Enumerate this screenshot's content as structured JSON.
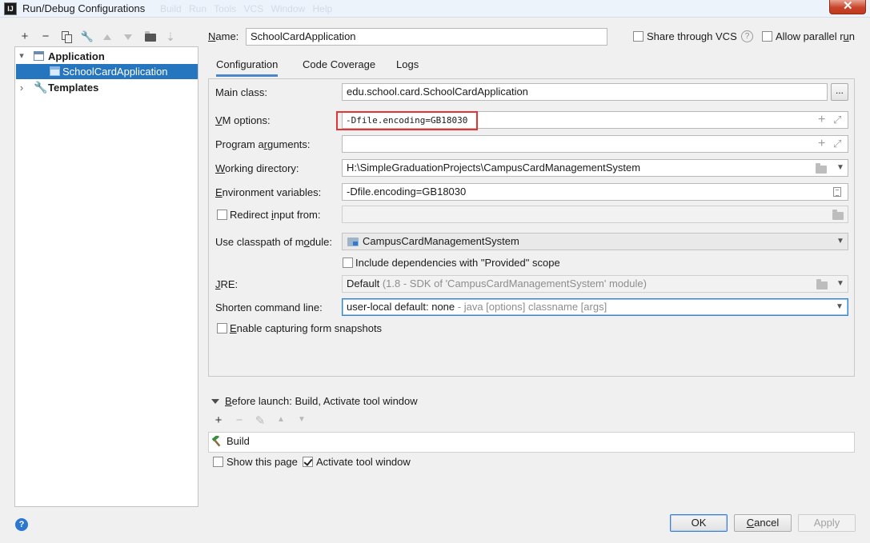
{
  "window": {
    "title": "Run/Debug Configurations",
    "app_icon_text": "IJ",
    "ghost_menu": "Build Run Tools VCS Window Help",
    "close_icon_glyph": "✕"
  },
  "left_toolbar": {
    "add": "+",
    "remove": "−",
    "edit": "🔧",
    "sort": "⇣"
  },
  "tree": {
    "application": {
      "label": "Application",
      "toggle": "▾"
    },
    "selected_item": {
      "label": "SchoolCardApplication"
    },
    "templates": {
      "label": "Templates",
      "toggle": "›"
    }
  },
  "name_row": {
    "label": {
      "pre": "",
      "u": "N",
      "post": "ame:"
    },
    "value": "SchoolCardApplication",
    "share_vcs": {
      "label": "Share through VCS",
      "checked": false
    },
    "help": "?",
    "allow_parallel": {
      "label": {
        "pre": "Allow parallel r",
        "u": "u",
        "post": "n"
      },
      "checked": false
    }
  },
  "tabs": [
    {
      "label": "Configuration",
      "active": true
    },
    {
      "label": "Code Coverage",
      "active": false
    },
    {
      "label": "Logs",
      "active": false
    }
  ],
  "config": {
    "main_class": {
      "label": "Main class:",
      "value": "edu.school.card.SchoolCardApplication",
      "browse": "..."
    },
    "vm_options": {
      "label": {
        "pre": "",
        "u": "V",
        "post": "M options:"
      },
      "value": "-Dfile.encoding=GB18030",
      "add": "+",
      "expand": "⤢"
    },
    "program_arguments": {
      "label": {
        "pre": "Program a",
        "u": "r",
        "post": "guments:"
      },
      "value": "",
      "add": "+",
      "expand": "⤢"
    },
    "working_directory": {
      "label": {
        "pre": "",
        "u": "W",
        "post": "orking directory:"
      },
      "value": "H:\\SimpleGraduationProjects\\CampusCardManagementSystem",
      "chevron": "▼"
    },
    "environment_variables": {
      "label": {
        "pre": "",
        "u": "E",
        "post": "nvironment variables:"
      },
      "value": "-Dfile.encoding=GB18030"
    },
    "redirect_input": {
      "label": {
        "pre": "Redirect ",
        "u": "i",
        "post": "nput from:"
      },
      "checked": false,
      "value": ""
    },
    "classpath_module": {
      "label": {
        "pre": "Use classpath of m",
        "u": "o",
        "post": "dule:"
      },
      "value": "CampusCardManagementSystem",
      "chevron": "▼"
    },
    "include_provided": {
      "label": "Include dependencies with \"Provided\" scope",
      "checked": false
    },
    "jre": {
      "label": {
        "pre": "",
        "u": "J",
        "post": "RE:"
      },
      "value_main": "Default",
      "value_muted": "(1.8 - SDK of 'CampusCardManagementSystem' module)",
      "chevron": "▼"
    },
    "shorten_cmd": {
      "label": "Shorten command line:",
      "value_main": "user-local default: none",
      "value_muted": "- java [options] classname [args]",
      "chevron": "▼"
    },
    "capture_snapshots": {
      "label": {
        "pre": "",
        "u": "E",
        "post": "nable capturing form snapshots"
      },
      "checked": false
    }
  },
  "before_launch": {
    "title": {
      "pre": "",
      "u": "B",
      "post": "efore launch: Build, Activate tool window"
    },
    "toolbar": {
      "add": "+",
      "remove": "−",
      "edit": "✎",
      "up": "▲",
      "down": "▼"
    },
    "items": [
      {
        "label": "Build"
      }
    ],
    "show_page": {
      "label": "Show this page",
      "checked": false
    },
    "activate_tool": {
      "label": "Activate tool window",
      "checked": true
    }
  },
  "footer": {
    "help": "?",
    "ok": "OK",
    "cancel": {
      "pre": "",
      "u": "C",
      "post": "ancel"
    },
    "apply": "Apply"
  },
  "colors": {
    "selection": "#2675bf",
    "annotation_box": "#e43533",
    "focus_border": "#2f82d6",
    "tab_underline": "#4a86c8",
    "hammer_green": "#3c8f3a"
  }
}
